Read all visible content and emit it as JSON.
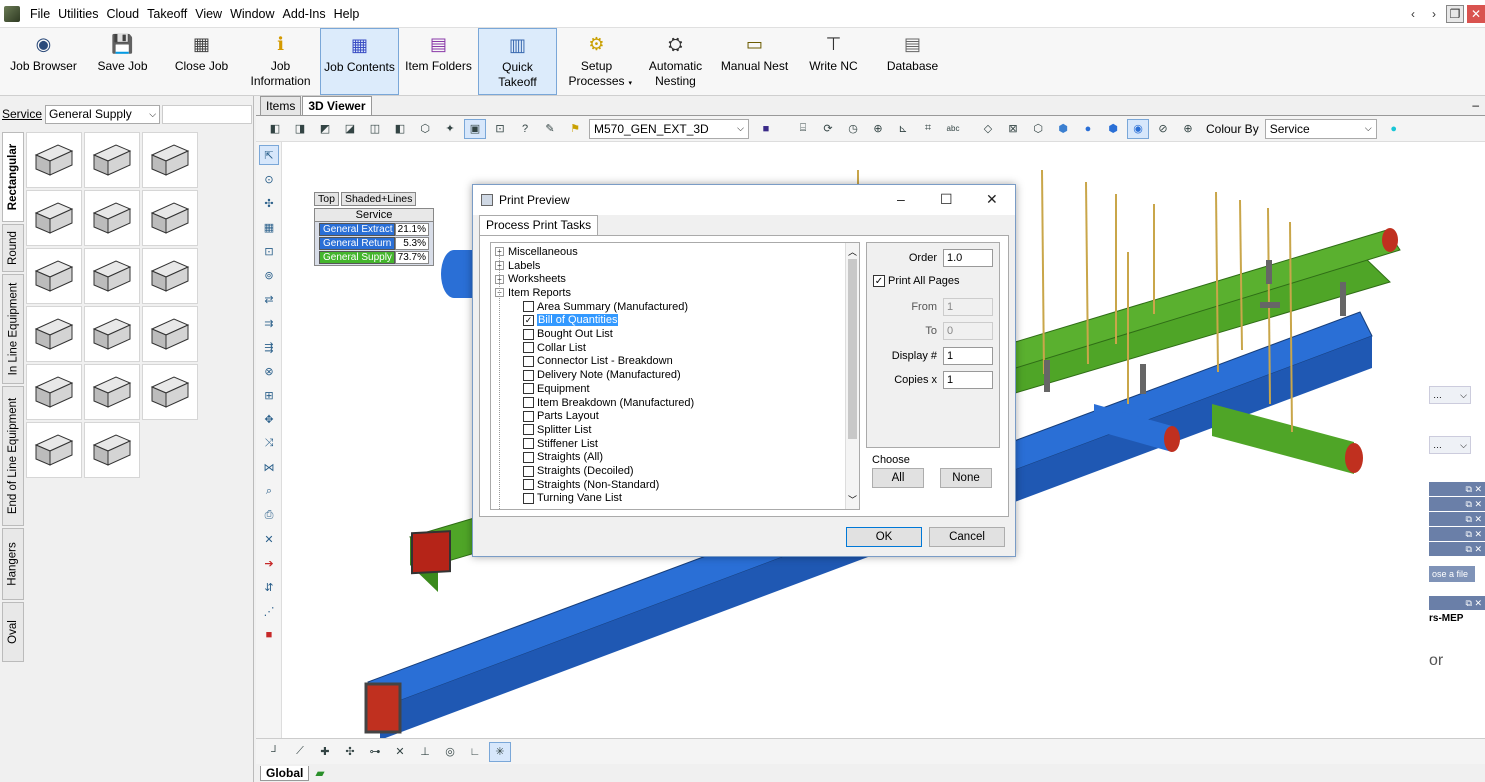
{
  "menu": [
    "File",
    "Utilities",
    "Cloud",
    "Takeoff",
    "View",
    "Window",
    "Add-Ins",
    "Help"
  ],
  "window_controls": {
    "back": "‹",
    "forward": "›",
    "restore": "❐",
    "close": "✕"
  },
  "ribbon": [
    {
      "label": "Job Browser",
      "icon": "job-browser-icon",
      "active": false
    },
    {
      "label": "Save Job",
      "icon": "save-icon",
      "active": false
    },
    {
      "label": "Close Job",
      "icon": "close-job-icon",
      "active": false
    },
    {
      "label": "Job\nInformation",
      "icon": "info-icon",
      "active": false
    },
    {
      "label": "Job Contents",
      "icon": "job-contents-icon",
      "active": true
    },
    {
      "label": "Item Folders",
      "icon": "item-folders-icon",
      "active": false
    },
    {
      "label": "Quick\nTakeoff",
      "icon": "quick-takeoff-icon",
      "active": true
    },
    {
      "label": "Setup\nProcesses",
      "icon": "gear-icon",
      "active": false,
      "dropdown": true
    },
    {
      "label": "Automatic\nNesting",
      "icon": "auto-nesting-icon",
      "active": false
    },
    {
      "label": "Manual Nest",
      "icon": "manual-nest-icon",
      "active": false
    },
    {
      "label": "Write NC",
      "icon": "write-nc-icon",
      "active": false
    },
    {
      "label": "Database",
      "icon": "database-icon",
      "active": false
    }
  ],
  "left_panel": {
    "service_label": "Service",
    "service_value": "General Supply",
    "tabs": [
      "Rectangular",
      "Round",
      "In Line Equipment",
      "End of Line Equipment",
      "Hangers",
      "Oval"
    ]
  },
  "viewer": {
    "tabs": [
      "Items",
      "3D Viewer"
    ],
    "active_tab": "3D Viewer",
    "minimize": "–",
    "layer_combo": "M570_GEN_EXT_3D",
    "colour_by_label": "Colour By",
    "colour_by_value": "Service",
    "status_tab": "Global"
  },
  "legend": {
    "view_tabs": [
      "Top",
      "Shaded+Lines"
    ],
    "header": "Service",
    "rows": [
      {
        "name": "General Extract",
        "value": "21.1%",
        "color": "#2a6fd6"
      },
      {
        "name": "General Return",
        "value": "5.3%",
        "color": "#2a6fd6"
      },
      {
        "name": "General Supply",
        "value": "73.7%",
        "color": "#44b52d"
      }
    ]
  },
  "right_panel": {
    "button": "ose a file",
    "text": "rs-MEP",
    "or": "or"
  },
  "dialog": {
    "title": "Print Preview",
    "tab": "Process Print Tasks",
    "tree": [
      {
        "label": "Miscellaneous",
        "level": 0,
        "expander": "+"
      },
      {
        "label": "Labels",
        "level": 0,
        "expander": "+"
      },
      {
        "label": "Worksheets",
        "level": 0,
        "expander": "+"
      },
      {
        "label": "Item Reports",
        "level": 0,
        "expander": "−"
      },
      {
        "label": "Area Summary (Manufactured)",
        "level": 1,
        "checked": false
      },
      {
        "label": "Bill of Quantities",
        "level": 1,
        "checked": true,
        "selected": true
      },
      {
        "label": "Bought Out List",
        "level": 1,
        "checked": false
      },
      {
        "label": "Collar List",
        "level": 1,
        "checked": false
      },
      {
        "label": "Connector List - Breakdown",
        "level": 1,
        "checked": false
      },
      {
        "label": "Delivery Note (Manufactured)",
        "level": 1,
        "checked": false
      },
      {
        "label": "Equipment",
        "level": 1,
        "checked": false
      },
      {
        "label": "Item Breakdown (Manufactured)",
        "level": 1,
        "checked": false
      },
      {
        "label": "Parts Layout",
        "level": 1,
        "checked": false
      },
      {
        "label": "Splitter List",
        "level": 1,
        "checked": false
      },
      {
        "label": "Stiffener List",
        "level": 1,
        "checked": false
      },
      {
        "label": "Straights (All)",
        "level": 1,
        "checked": false
      },
      {
        "label": "Straights (Decoiled)",
        "level": 1,
        "checked": false
      },
      {
        "label": "Straights (Non-Standard)",
        "level": 1,
        "checked": false
      },
      {
        "label": "Turning Vane List",
        "level": 1,
        "checked": false
      }
    ],
    "options": {
      "order_label": "Order",
      "order_value": "1.0",
      "print_all_label": "Print All Pages",
      "print_all_checked": true,
      "from_label": "From",
      "from_value": "1",
      "to_label": "To",
      "to_value": "0",
      "display_label": "Display #",
      "display_value": "1",
      "copies_label": "Copies x",
      "copies_value": "1"
    },
    "choose_label": "Choose",
    "all_button": "All",
    "none_button": "None",
    "ok_button": "OK",
    "cancel_button": "Cancel"
  }
}
